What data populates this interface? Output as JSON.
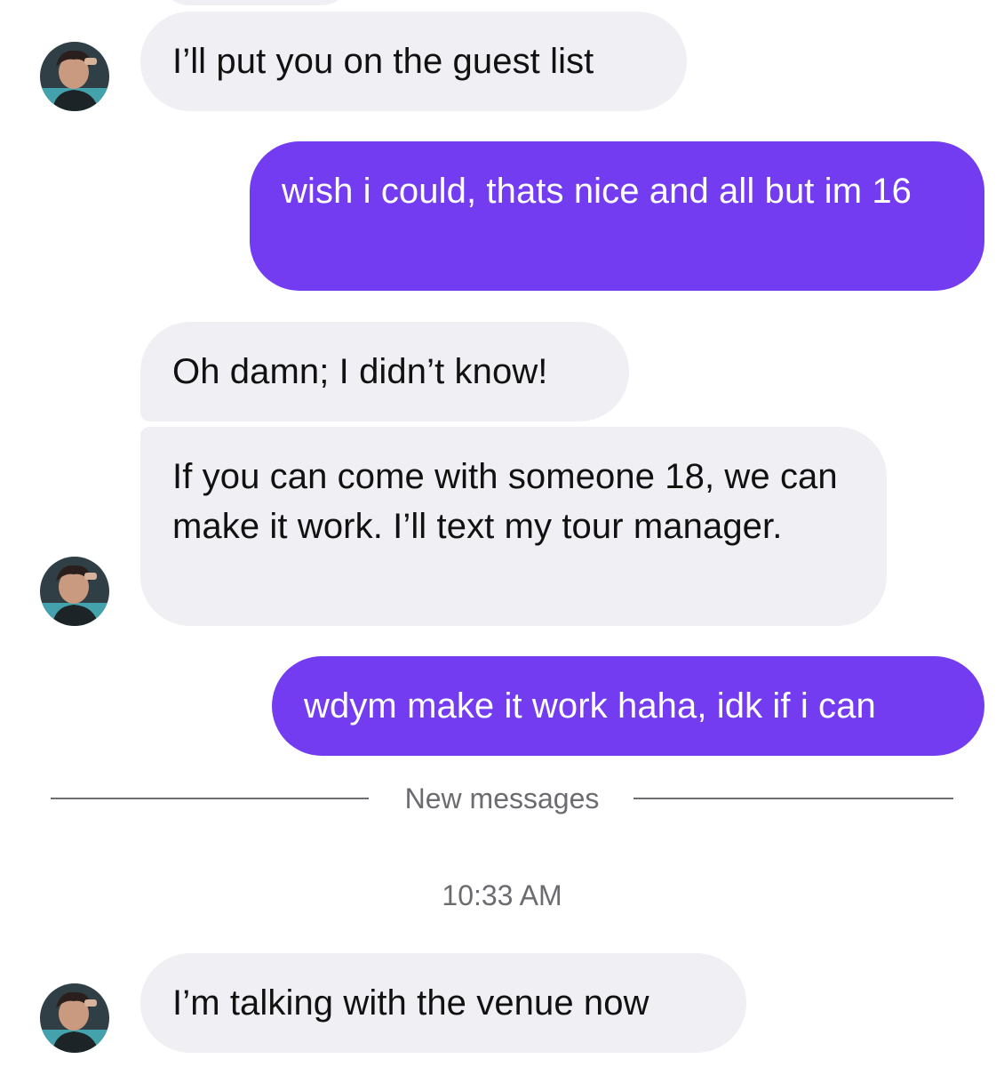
{
  "conversation": {
    "messages": [
      {
        "sender": "them",
        "text": "I’ll put you on the guest list"
      },
      {
        "sender": "me",
        "text": "wish i could, thats nice and all but im 16"
      },
      {
        "sender": "them",
        "text": "Oh damn; I didn’t know!"
      },
      {
        "sender": "them",
        "text": "If you can come with someone 18, we can make it work. I’ll text my tour manager."
      },
      {
        "sender": "me",
        "text": "wdym make it work haha, idk if i can"
      },
      {
        "sender": "them",
        "text": "I’m talking with the venue now"
      }
    ],
    "divider_label": "New messages",
    "timestamp": "10:33 AM"
  },
  "colors": {
    "outgoing_bubble": "#733cf0",
    "incoming_bubble": "#efeff4",
    "meta_text": "#6b6b70"
  },
  "icons": {
    "avatar": "contact-avatar-photo"
  }
}
